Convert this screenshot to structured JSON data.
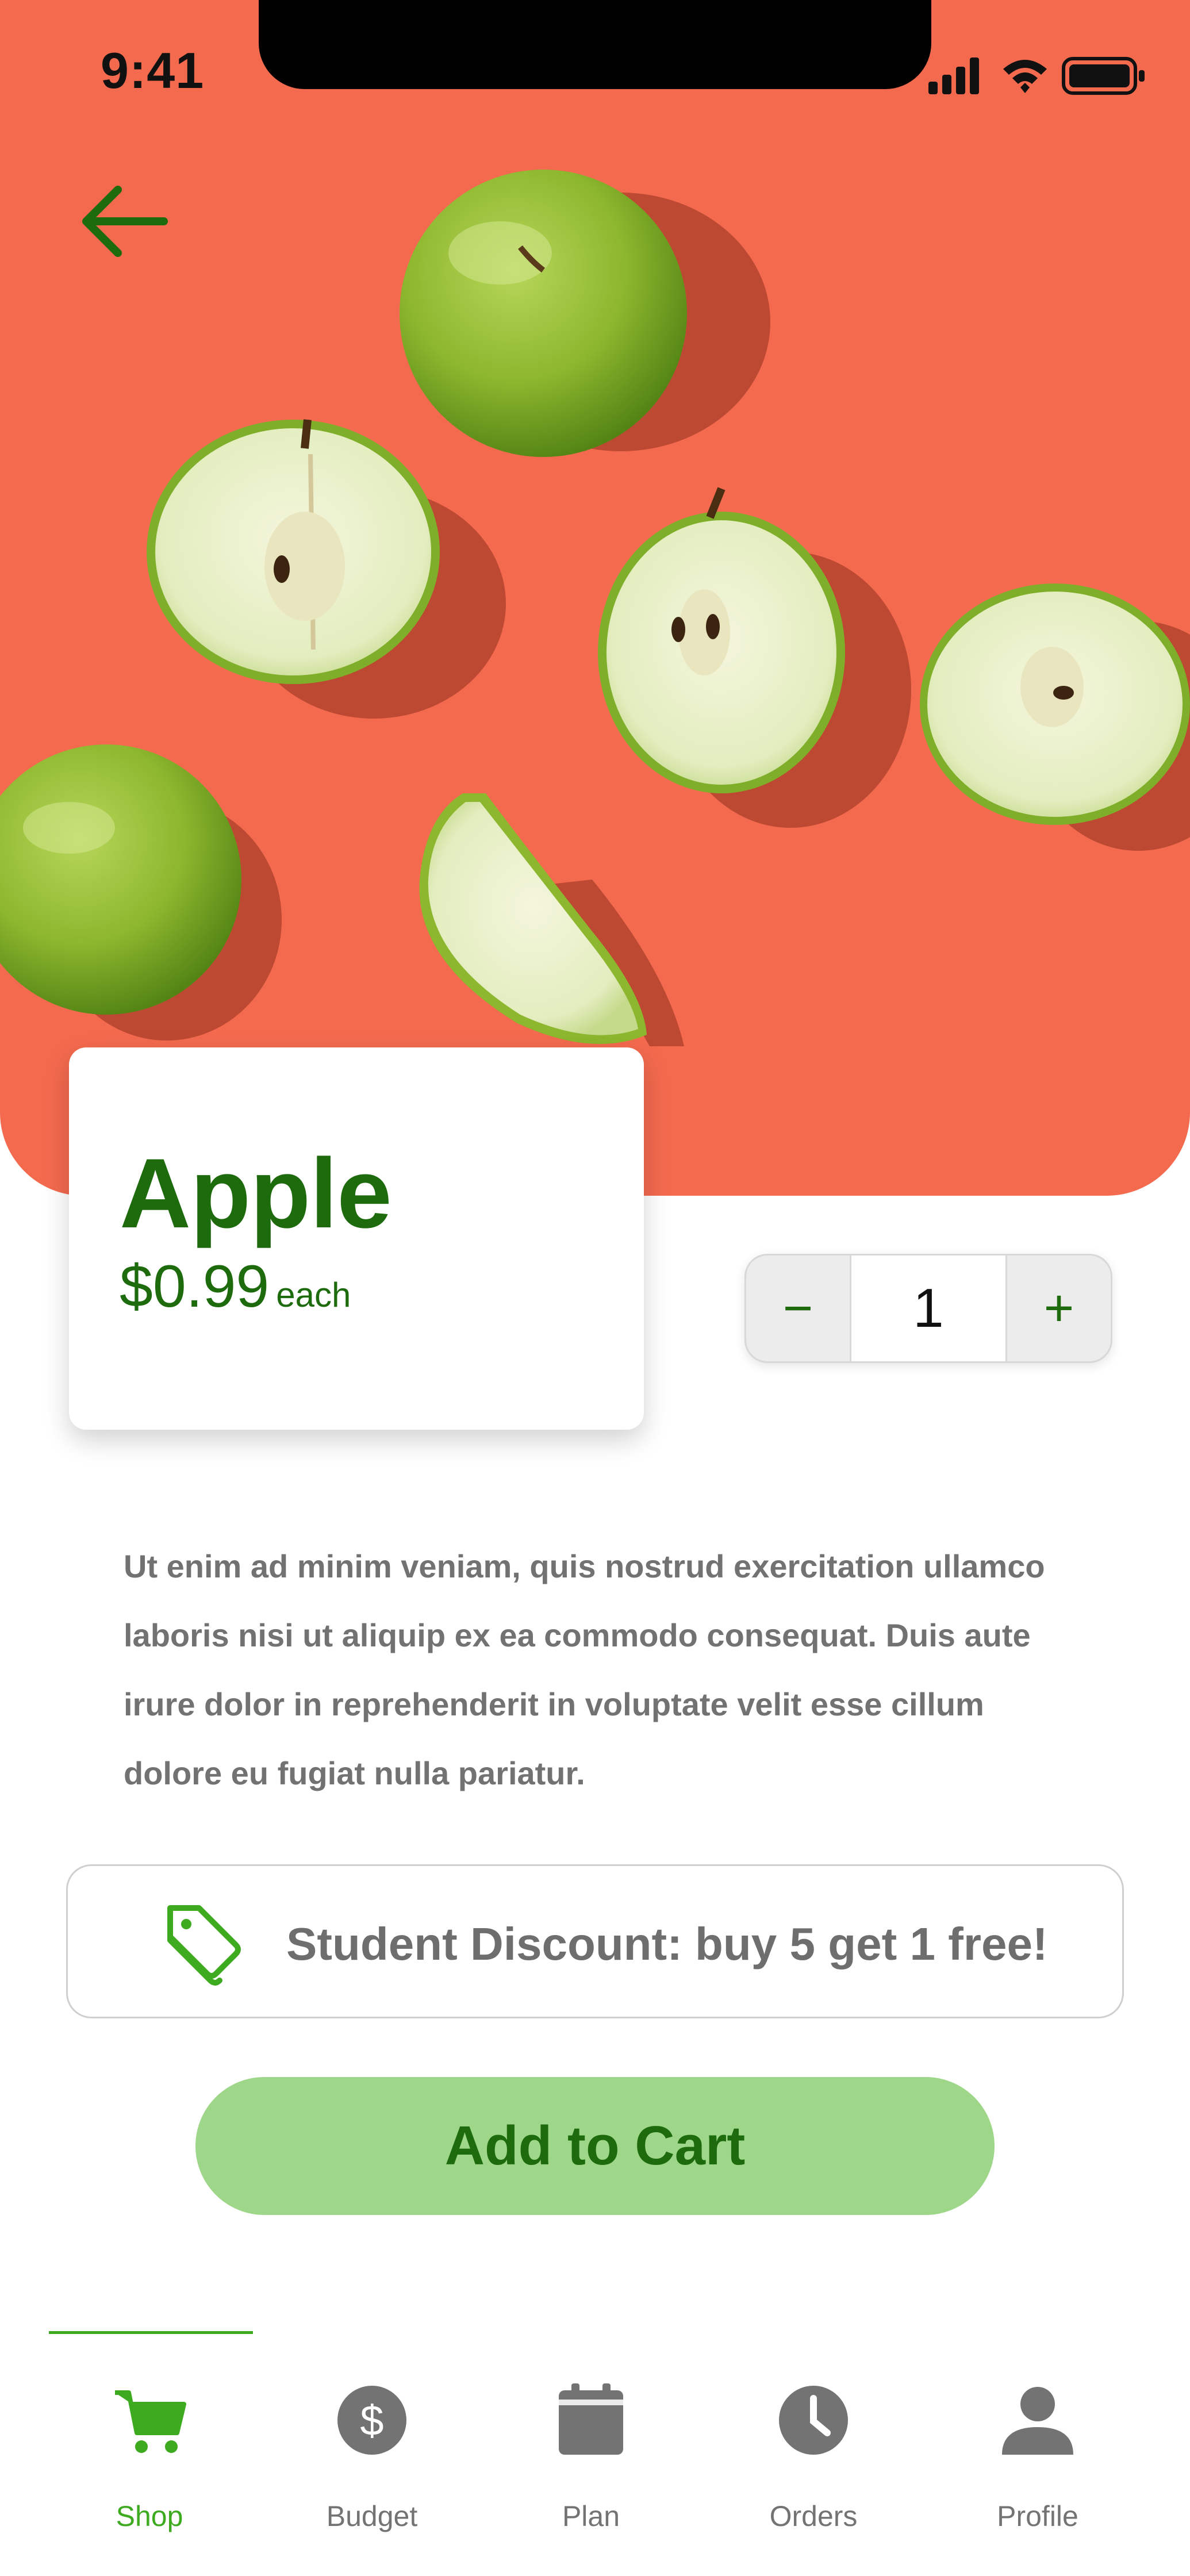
{
  "status_bar": {
    "time": "9:41",
    "icons": [
      "signal-icon",
      "wifi-icon",
      "battery-icon"
    ]
  },
  "hero": {
    "background_color": "#F36A4E",
    "image_subject": "green apples"
  },
  "header": {
    "back_icon": "arrow-left-icon"
  },
  "product": {
    "name": "Apple",
    "price": "$0.99",
    "unit": "each"
  },
  "quantity": {
    "decrement_label": "−",
    "value": "1",
    "increment_label": "+"
  },
  "description": "Ut enim ad minim veniam, quis nostrud exercitation ullamco laboris nisi ut aliquip ex ea commodo consequat. Duis aute irure dolor in reprehenderit in voluptate velit esse cillum dolore eu fugiat nulla pariatur.",
  "discount": {
    "icon": "tag-icon",
    "text": "Student Discount: buy 5 get 1 free!"
  },
  "add_to_cart_label": "Add to Cart",
  "colors": {
    "brand_green": "#1E6B0E",
    "active_green": "#3DAA20",
    "button_green": "#9ED78A",
    "inactive_gray": "#737373"
  },
  "nav": {
    "items": [
      {
        "label": "Shop",
        "icon": "cart-icon",
        "active": true
      },
      {
        "label": "Budget",
        "icon": "dollar-icon",
        "active": false
      },
      {
        "label": "Plan",
        "icon": "calendar-icon",
        "active": false
      },
      {
        "label": "Orders",
        "icon": "clock-icon",
        "active": false
      },
      {
        "label": "Profile",
        "icon": "person-icon",
        "active": false
      }
    ]
  }
}
